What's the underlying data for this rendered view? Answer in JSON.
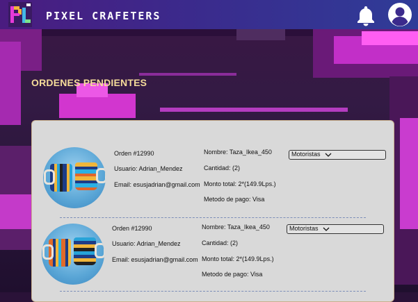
{
  "header": {
    "brand": "PIXEL CRAFETERS"
  },
  "page": {
    "title": "ORDENES PENDIENTES"
  },
  "orders": [
    {
      "order": "Orden #12990",
      "user": "Usuario: Adrian_Mendez",
      "email": "Email: esusjadrian@gmail.com",
      "name": "Nombre: Taza_Ikea_450",
      "qty": "Cantidad: (2)",
      "total": "Monto total: 2*(149.9Lps.)",
      "payment": "Metodo de pago: Visa",
      "assign": "Motoristas"
    },
    {
      "order": "Orden #12990",
      "user": "Usuario: Adrian_Mendez",
      "email": "Email: esusjadrian@gmail.com",
      "name": "Nombre: Taza_Ikea_450",
      "qty": "Cantidad: (2)",
      "total": "Monto total: 2*(149.9Lps.)",
      "payment": "Metodo de pago: Visa",
      "assign": "Motoristas"
    }
  ],
  "icons": {
    "logo": "pc-logo-icon",
    "notifications": "bell-icon",
    "account": "user-avatar-icon",
    "dropdown": "chevron-down-icon"
  },
  "colors": {
    "title": "#f5dc9a",
    "panel": "#d9d9d9",
    "accent_pink": "#e13bd8"
  }
}
